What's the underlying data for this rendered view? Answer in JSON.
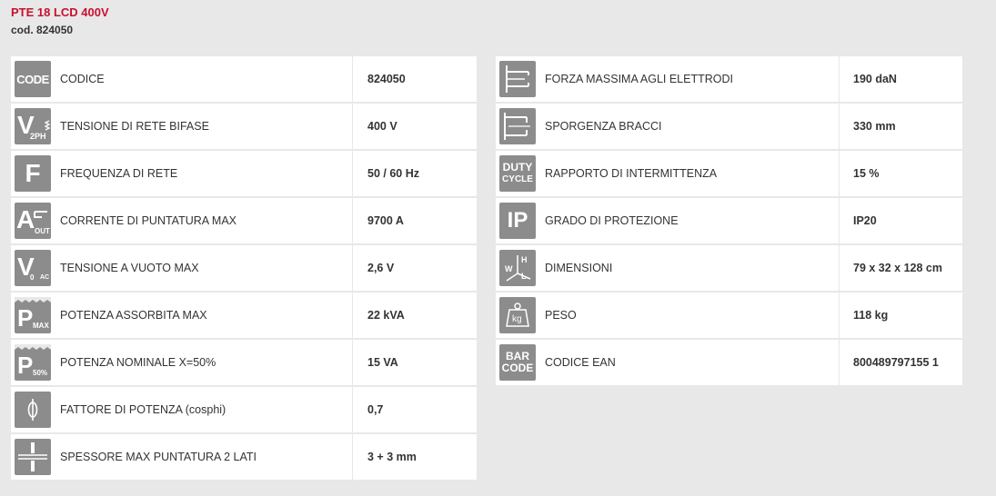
{
  "header": {
    "title": "PTE 18 LCD 400V",
    "code": "cod. 824050"
  },
  "left_rows": [
    {
      "icon": "code-icon",
      "label": "CODICE",
      "value": "824050"
    },
    {
      "icon": "voltage-2ph-icon",
      "label": "TENSIONE DI RETE BIFASE",
      "value": "400 V"
    },
    {
      "icon": "frequency-icon",
      "label": "FREQUENZA DI RETE",
      "value": "50 / 60 Hz"
    },
    {
      "icon": "output-current-icon",
      "label": "CORRENTE DI PUNTATURA MAX",
      "value": "9700 A"
    },
    {
      "icon": "open-circuit-voltage-icon",
      "label": "TENSIONE A VUOTO MAX",
      "value": "2,6 V"
    },
    {
      "icon": "power-max-icon",
      "label": "POTENZA ASSORBITA MAX",
      "value": "22 kVA"
    },
    {
      "icon": "power-50-icon",
      "label": "POTENZA NOMINALE X=50%",
      "value": "15 VA"
    },
    {
      "icon": "power-factor-icon",
      "label": "FATTORE DI POTENZA (cosphi)",
      "value": "0,7"
    },
    {
      "icon": "weld-thickness-icon",
      "label": "SPESSORE MAX PUNTATURA 2 LATI",
      "value": "3 + 3 mm"
    }
  ],
  "right_rows": [
    {
      "icon": "electrode-force-icon",
      "label": "FORZA MASSIMA AGLI ELETTRODI",
      "value": "190 daN"
    },
    {
      "icon": "arm-reach-icon",
      "label": "SPORGENZA BRACCI",
      "value": "330 mm"
    },
    {
      "icon": "duty-cycle-icon",
      "label": "RAPPORTO DI INTERMITTENZA",
      "value": "15 %"
    },
    {
      "icon": "ip-rating-icon",
      "label": "GRADO DI PROTEZIONE",
      "value": "IP20"
    },
    {
      "icon": "dimensions-icon",
      "label": "DIMENSIONI",
      "value": "79 x 32 x 128 cm"
    },
    {
      "icon": "weight-icon",
      "label": "PESO",
      "value": "118 kg"
    },
    {
      "icon": "barcode-icon",
      "label": "CODICE EAN",
      "value": "800489797155 1"
    }
  ],
  "icon_texts": {
    "code": "CODE",
    "v": "V",
    "v_2ph": "2PH",
    "f": "F",
    "a": "A",
    "a_out": "OUT",
    "v0": "V",
    "v0_sub": "0",
    "v0_ac": "AC",
    "p": "P",
    "p_max": "MAX",
    "p_50": "50%",
    "duty": "DUTY",
    "cycle": "CYCLE",
    "ip": "IP",
    "w": "W",
    "h": "H",
    "l": "L",
    "kg": "kg",
    "bar": "BAR",
    "barcode": "CODE"
  },
  "colors": {
    "title": "#c8102e",
    "icon_bg": "#8c8c8c",
    "page_bg": "#e8e8e8"
  }
}
